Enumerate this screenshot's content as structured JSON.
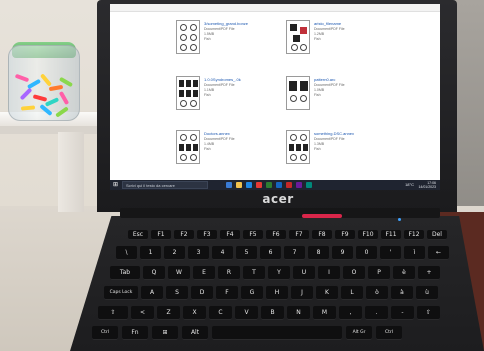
{
  "scene": {
    "laptop_brand": "acer",
    "screen": {
      "explorer_path": "",
      "files": [
        {
          "name": "3/someting_grand.bonze",
          "meta": [
            "Document/PDF File",
            "1.5MB",
            "Fish"
          ]
        },
        {
          "name": "aristo_filename",
          "meta": [
            "Document/PDF File",
            "1.2MB",
            "Fish"
          ]
        },
        {
          "name": "1.0.0Syndromes_.0k",
          "meta": [
            "Document/PDF File",
            "1.1MB",
            "Fish"
          ]
        },
        {
          "name": "pattern0.arc",
          "meta": [
            "Document/PDF File",
            "1.0MB",
            "Fish"
          ]
        },
        {
          "name": "Doctors.annex",
          "meta": [
            "Document/PDF File",
            "1.4MB",
            "Fish"
          ]
        },
        {
          "name": "something.DSC.annex",
          "meta": [
            "Document/PDF File",
            "1.3MB",
            "Fish"
          ]
        }
      ],
      "taskbar": {
        "search_placeholder": "Scrivi qui il testo da cercare",
        "tray": "18°C",
        "time": "17:06",
        "date": "14/01/2023"
      }
    },
    "keyboard": {
      "row_fn": [
        "Esc",
        "F1",
        "F2",
        "F3",
        "F4",
        "F5",
        "F6",
        "F7",
        "F8",
        "F9",
        "F10",
        "F11",
        "F12",
        "Del"
      ],
      "row_num": [
        "\\",
        "1",
        "2",
        "3",
        "4",
        "5",
        "6",
        "7",
        "8",
        "9",
        "0",
        "'",
        "ì",
        "←"
      ],
      "row_q": [
        "Tab",
        "Q",
        "W",
        "E",
        "R",
        "T",
        "Y",
        "U",
        "I",
        "O",
        "P",
        "è",
        "+"
      ],
      "row_a": [
        "Caps Lock",
        "A",
        "S",
        "D",
        "F",
        "G",
        "H",
        "J",
        "K",
        "L",
        "ò",
        "à",
        "ù"
      ],
      "row_z": [
        "⇧",
        "<",
        "Z",
        "X",
        "C",
        "V",
        "B",
        "N",
        "M",
        ",",
        ".",
        "-",
        "⇧"
      ],
      "row_bottom": [
        "Ctrl",
        "Fn",
        "⊞",
        "Alt",
        "",
        "Alt Gr",
        "Ctrl"
      ]
    }
  }
}
